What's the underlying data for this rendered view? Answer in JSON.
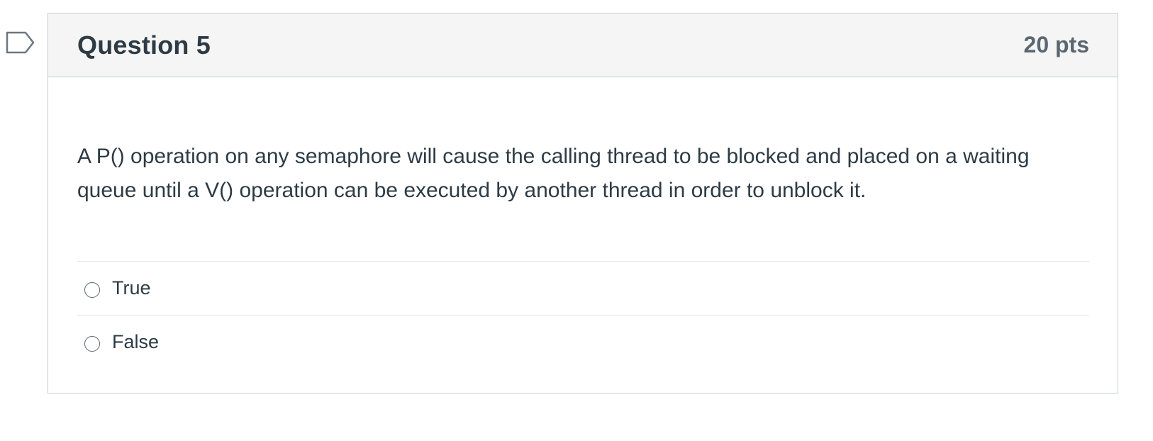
{
  "question": {
    "title": "Question 5",
    "points": "20 pts",
    "text": "A P() operation on any semaphore will cause the calling thread to be blocked and placed on a waiting queue until a V() operation can be executed by another thread in order to unblock it.",
    "answers": [
      {
        "label": "True",
        "selected": false
      },
      {
        "label": "False",
        "selected": false
      }
    ]
  },
  "icons": {
    "flag": "flag-question-icon"
  },
  "colors": {
    "header_bg": "#f5f5f5",
    "border": "#c7cdd1",
    "text": "#2d3b45",
    "points": "#5b6770",
    "flag_outline": "#6b7780"
  }
}
